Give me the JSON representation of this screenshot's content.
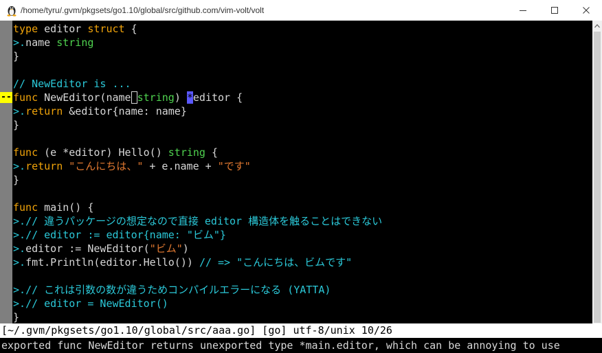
{
  "window": {
    "title": "/home/tyru/.gvm/pkgsets/go1.10/global/src/github.com/vim-volt/volt",
    "icon": "tux-icon",
    "controls": {
      "minimize": "minimize-icon",
      "maximize": "maximize-icon",
      "close": "close-icon"
    }
  },
  "editor": {
    "sign_text": "--",
    "sign_line": 5,
    "lines": [
      [
        {
          "t": "type ",
          "c": "kw"
        },
        {
          "t": "editor ",
          "c": "id"
        },
        {
          "t": "struct",
          "c": "kw"
        },
        {
          "t": " {",
          "c": "id"
        }
      ],
      [
        {
          "t": ">.",
          "c": "lt"
        },
        {
          "t": "name ",
          "c": "id"
        },
        {
          "t": "string",
          "c": "type"
        }
      ],
      [
        {
          "t": "}",
          "c": "id"
        }
      ],
      [],
      [
        {
          "t": "// NewEditor is ...",
          "c": "cm"
        }
      ],
      [
        {
          "t": "func ",
          "c": "kw"
        },
        {
          "t": "NewEditor(name",
          "c": "id"
        },
        {
          "t": " ",
          "c": "id",
          "x": "box"
        },
        {
          "t": "string",
          "c": "type"
        },
        {
          "t": ") ",
          "c": "id"
        },
        {
          "t": "*",
          "c": "id",
          "x": "hl"
        },
        {
          "t": "editor {",
          "c": "id"
        }
      ],
      [
        {
          "t": ">.",
          "c": "lt"
        },
        {
          "t": "return ",
          "c": "kw"
        },
        {
          "t": "&editor{name: name}",
          "c": "id"
        }
      ],
      [
        {
          "t": "}",
          "c": "id"
        }
      ],
      [],
      [
        {
          "t": "func ",
          "c": "kw"
        },
        {
          "t": "(e *editor) Hello() ",
          "c": "id"
        },
        {
          "t": "string",
          "c": "type"
        },
        {
          "t": " {",
          "c": "id"
        }
      ],
      [
        {
          "t": ">.",
          "c": "lt"
        },
        {
          "t": "return ",
          "c": "kw"
        },
        {
          "t": "\"こんにちは、\"",
          "c": "str"
        },
        {
          "t": " + e.name + ",
          "c": "id"
        },
        {
          "t": "\"です\"",
          "c": "str"
        }
      ],
      [
        {
          "t": "}",
          "c": "id"
        }
      ],
      [],
      [
        {
          "t": "func ",
          "c": "kw"
        },
        {
          "t": "main() {",
          "c": "id"
        }
      ],
      [
        {
          "t": ">.",
          "c": "lt"
        },
        {
          "t": "// 違うパッケージの想定なので直接 editor 構造体を触ることはできない",
          "c": "cm"
        }
      ],
      [
        {
          "t": ">.",
          "c": "lt"
        },
        {
          "t": "// editor := editor{name: \"ビム\"}",
          "c": "cm"
        }
      ],
      [
        {
          "t": ">.",
          "c": "lt"
        },
        {
          "t": "editor := NewEditor(",
          "c": "id"
        },
        {
          "t": "\"ビム\"",
          "c": "str"
        },
        {
          "t": ")",
          "c": "id"
        }
      ],
      [
        {
          "t": ">.",
          "c": "lt"
        },
        {
          "t": "fmt.Println(editor.Hello()) ",
          "c": "id"
        },
        {
          "t": "// => \"こんにちは、ビムです\"",
          "c": "cm"
        }
      ],
      [],
      [
        {
          "t": ">.",
          "c": "lt"
        },
        {
          "t": "// これは引数の数が違うためコンパイルエラーになる (YATTA)",
          "c": "cm"
        }
      ],
      [
        {
          "t": ">.",
          "c": "lt"
        },
        {
          "t": "// editor = NewEditor()",
          "c": "cm"
        }
      ],
      [
        {
          "t": "}",
          "c": "id"
        }
      ]
    ]
  },
  "statusline": {
    "text": "[~/.gvm/pkgsets/go1.10/global/src/aaa.go] [go] utf-8/unix 10/26"
  },
  "message": {
    "text": "exported func NewEditor returns unexported type *main.editor, which can be annoying to use"
  },
  "colors": {
    "keyword": "#f0a30a",
    "type": "#4fd24f",
    "comment": "#2bc8d8",
    "string": "#e07830",
    "sign_bg": "#ffff00",
    "cursor_hl": "#5a58ff"
  }
}
